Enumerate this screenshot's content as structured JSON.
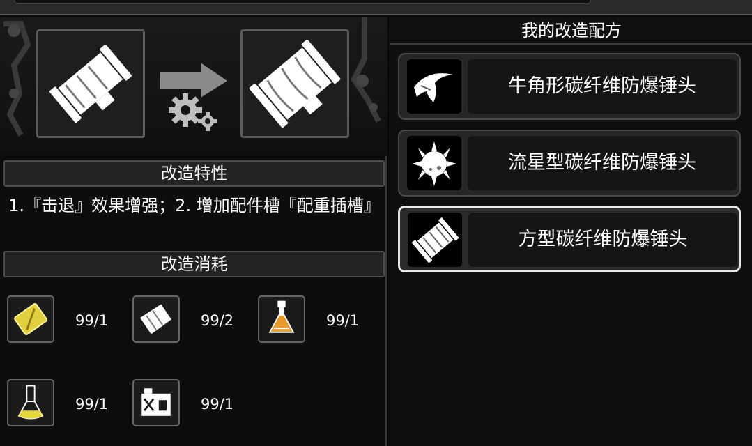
{
  "banner": {
    "source_item_icon": "square-hammer-head-icon",
    "target_item_icon": "square-hammer-head-upgraded-icon",
    "arrow_icon": "arrow-right-icon",
    "gear_icon": "gears-icon"
  },
  "left": {
    "traits_title": "改造特性",
    "traits_desc": "1.『击退』效果增强；2. 增加配件槽『配重插槽』",
    "cost_title": "改造消耗",
    "costs": [
      {
        "icon": "gold-plate-icon",
        "qty": "99/1",
        "color": "#d8c23a"
      },
      {
        "icon": "cloth-sheet-icon",
        "qty": "99/2",
        "color": "#ffffff"
      },
      {
        "icon": "orange-potion-flask-icon",
        "qty": "99/1",
        "color": "#e59a2a"
      },
      {
        "icon": "yellow-liquid-flask-icon",
        "qty": "99/1",
        "color": "#e5d83a"
      },
      {
        "icon": "battery-box-icon",
        "qty": "99/1",
        "color": "#ffffff"
      }
    ]
  },
  "right": {
    "title": "我的改造配方",
    "recipes": [
      {
        "name": "牛角形碳纤维防爆锤头",
        "icon": "horn-hammer-head-icon",
        "selected": false
      },
      {
        "name": "流星型碳纤维防爆锤头",
        "icon": "meteor-hammer-head-icon",
        "selected": false
      },
      {
        "name": "方型碳纤维防爆锤头",
        "icon": "square-hammer-head-icon",
        "selected": true
      }
    ]
  }
}
